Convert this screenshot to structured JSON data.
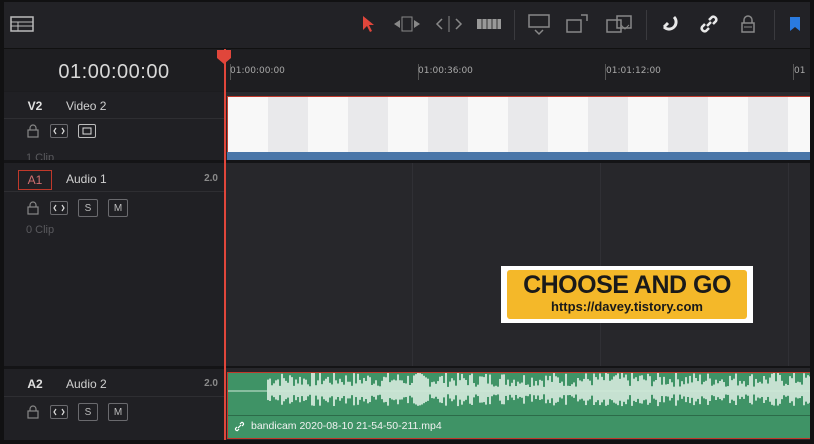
{
  "toolbar": {
    "icons": [
      "layout-icon",
      "pointer-icon",
      "trim-icon",
      "dynamic-trim-icon",
      "blade-icon",
      "insert-icon",
      "overwrite-icon",
      "replace-icon",
      "snapping-icon",
      "link-icon",
      "lock-icon",
      "flag-icon"
    ]
  },
  "timecode": "01:00:00:00",
  "ruler": {
    "labels": [
      "01:00:00:00",
      "01:00:36:00",
      "01:01:12:00",
      "01"
    ]
  },
  "tracks": {
    "v2": {
      "id": "V2",
      "name": "Video 2",
      "clips": "1 Clip"
    },
    "a1": {
      "id": "A1",
      "name": "Audio 1",
      "level": "2.0",
      "clips": "0 Clip",
      "solo": "S",
      "mute": "M"
    },
    "a2": {
      "id": "A2",
      "name": "Audio 2",
      "level": "2.0",
      "solo": "S",
      "mute": "M"
    }
  },
  "audio_clip": {
    "name": "bandicam 2020-08-10 21-54-50-211.mp4"
  },
  "overlay": {
    "title": "CHOOSE AND GO",
    "url": "https://davey.tistory.com"
  },
  "colors": {
    "accent": "#e0463b",
    "audio_clip": "#3f9366",
    "video_bar": "#4a76a8",
    "overlay_bg": "#f4b829"
  }
}
